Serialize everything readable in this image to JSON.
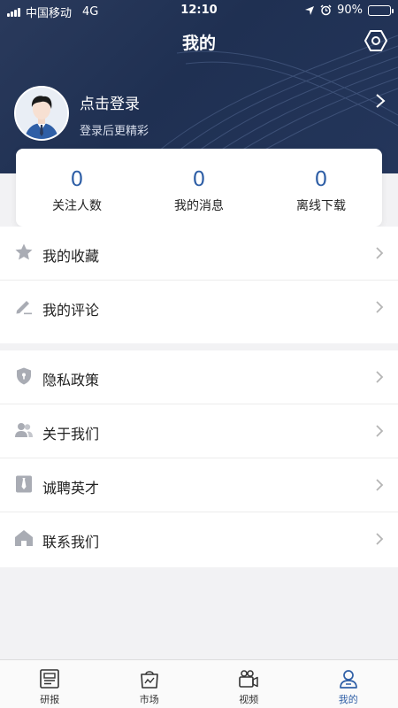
{
  "status_bar": {
    "carrier": "中国移动",
    "network": "4G",
    "time": "12:10",
    "battery": "90%",
    "battery_level": 0.9
  },
  "header": {
    "title": "我的"
  },
  "profile": {
    "login_text": "点击登录",
    "subtitle": "登录后更精彩"
  },
  "stats": [
    {
      "value": "0",
      "label": "关注人数"
    },
    {
      "value": "0",
      "label": "我的消息"
    },
    {
      "value": "0",
      "label": "离线下载"
    }
  ],
  "menu_group1": [
    {
      "label": "我的收藏",
      "icon": "star-icon"
    },
    {
      "label": "我的评论",
      "icon": "edit-icon"
    }
  ],
  "menu_group2": [
    {
      "label": "隐私政策",
      "icon": "shield-icon"
    },
    {
      "label": "关于我们",
      "icon": "users-icon"
    },
    {
      "label": "诚聘英才",
      "icon": "tie-icon"
    },
    {
      "label": "联系我们",
      "icon": "home-icon"
    }
  ],
  "tabbar": [
    {
      "label": "研报",
      "icon": "report-icon"
    },
    {
      "label": "市场",
      "icon": "market-bag-icon"
    },
    {
      "label": "视频",
      "icon": "video-camera-icon"
    },
    {
      "label": "我的",
      "icon": "person-icon",
      "active": true
    }
  ],
  "colors": {
    "header_bg": "#1f3052",
    "accent": "#2f5fa6",
    "page_bg": "#f2f2f4",
    "icon_gray": "#a9acb4"
  }
}
